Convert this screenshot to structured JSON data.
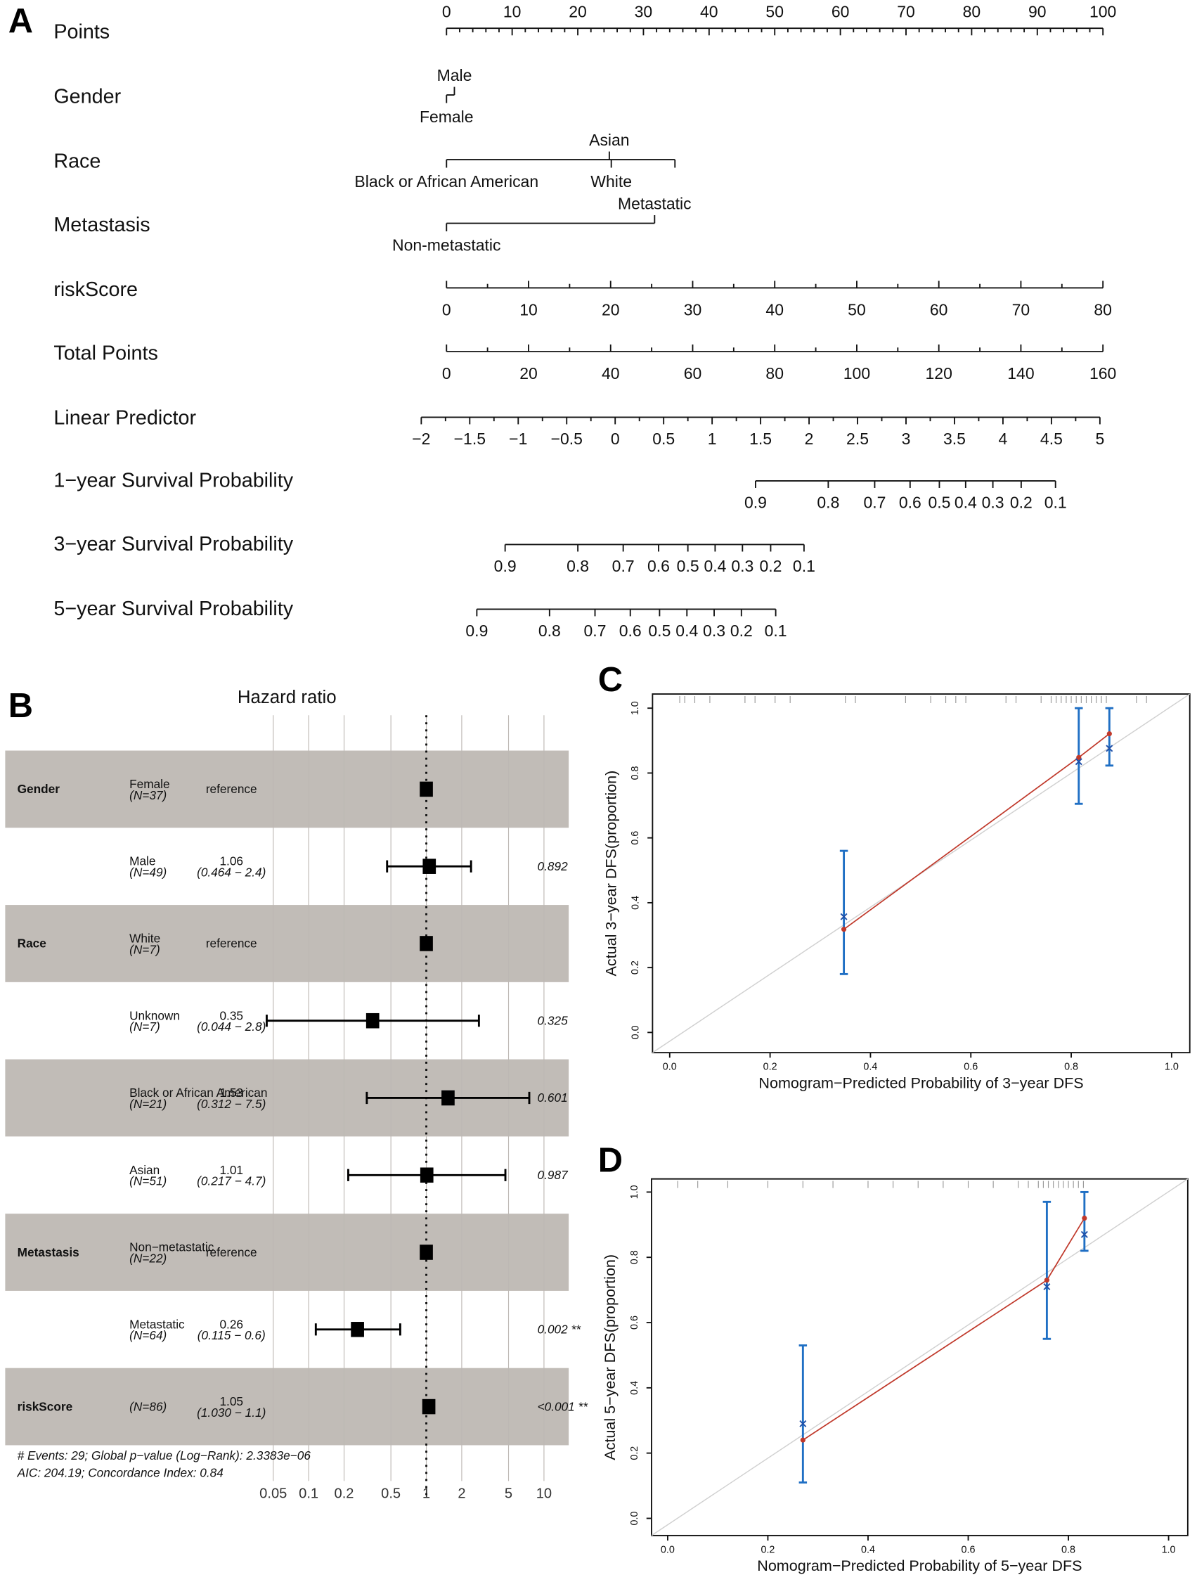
{
  "panels": {
    "a": "A",
    "b": "B",
    "c": "C",
    "d": "D"
  },
  "chart_data": [
    {
      "type": "nomogram",
      "rows": [
        {
          "label": "Points",
          "kind": "scale",
          "min": 0,
          "max": 100,
          "major": 10,
          "minor": 2,
          "labels_above": true
        },
        {
          "label": "Gender",
          "kind": "factor",
          "levels": [
            {
              "name": "Female",
              "points": 0,
              "pos": "below"
            },
            {
              "name": "Male",
              "points": 1.2,
              "pos": "above"
            }
          ]
        },
        {
          "label": "Race",
          "kind": "factor",
          "levels": [
            {
              "name": "Black or African American",
              "points": 0,
              "pos": "below"
            },
            {
              "name": "Asian",
              "points": 24.8,
              "pos": "above"
            },
            {
              "name": "White",
              "points": 25.1,
              "pos": "below"
            },
            {
              "name": "",
              "points": 34.8,
              "pos": "none"
            }
          ]
        },
        {
          "label": "Metastasis",
          "kind": "factor",
          "levels": [
            {
              "name": "Non-metastatic",
              "points": 0,
              "pos": "below"
            },
            {
              "name": "Metastatic",
              "points": 31.7,
              "pos": "above"
            }
          ]
        },
        {
          "label": "riskScore",
          "kind": "scale",
          "min": 0,
          "max": 80,
          "major": 10,
          "minor": 5,
          "points_max": 100
        },
        {
          "label": "Total Points",
          "kind": "scale",
          "min": 0,
          "max": 160,
          "major": 20,
          "minor": 10,
          "total": true
        },
        {
          "label": "Linear Predictor",
          "kind": "lp",
          "min": -2,
          "max": 5,
          "major": 0.5,
          "tick_labels": [
            "−2",
            "−1.5",
            "−1",
            "−0.5",
            "0",
            "0.5",
            "1",
            "1.5",
            "2",
            "2.5",
            "3",
            "3.5",
            "4",
            "4.5",
            "5"
          ]
        },
        {
          "label": "1−year Survival Probability",
          "kind": "surv",
          "ticks": [
            {
              "p": "0.9",
              "lp": 1.448
            },
            {
              "p": "0.8",
              "lp": 2.198
            },
            {
              "p": "0.7",
              "lp": 2.677
            },
            {
              "p": "0.6",
              "lp": 3.042
            },
            {
              "p": "0.5",
              "lp": 3.344
            },
            {
              "p": "0.4",
              "lp": 3.615
            },
            {
              "p": "0.3",
              "lp": 3.896
            },
            {
              "p": "0.2",
              "lp": 4.188
            },
            {
              "p": "0.1",
              "lp": 4.542
            }
          ]
        },
        {
          "label": "3−year Survival Probability",
          "kind": "surv",
          "ticks": [
            {
              "p": "0.9",
              "lp": -1.135
            },
            {
              "p": "0.8",
              "lp": -0.385
            },
            {
              "p": "0.7",
              "lp": 0.083
            },
            {
              "p": "0.6",
              "lp": 0.448
            },
            {
              "p": "0.5",
              "lp": 0.75
            },
            {
              "p": "0.4",
              "lp": 1.031
            },
            {
              "p": "0.3",
              "lp": 1.313
            },
            {
              "p": "0.2",
              "lp": 1.604
            },
            {
              "p": "0.1",
              "lp": 1.948
            }
          ]
        },
        {
          "label": "5−year Survival Probability",
          "kind": "surv",
          "ticks": [
            {
              "p": "0.9",
              "lp": -1.427
            },
            {
              "p": "0.8",
              "lp": -0.677
            },
            {
              "p": "0.7",
              "lp": -0.208
            },
            {
              "p": "0.6",
              "lp": 0.156
            },
            {
              "p": "0.5",
              "lp": 0.458
            },
            {
              "p": "0.4",
              "lp": 0.74
            },
            {
              "p": "0.3",
              "lp": 1.021
            },
            {
              "p": "0.2",
              "lp": 1.302
            },
            {
              "p": "0.1",
              "lp": 1.656
            }
          ]
        }
      ]
    },
    {
      "type": "forest",
      "title": "Hazard ratio",
      "x_scale": "log",
      "x_ticks": [
        "0.05",
        "0.1",
        "0.2",
        "0.5",
        "1",
        "2",
        "5",
        "10"
      ],
      "shade_color": "#c1bcb7",
      "rows": [
        {
          "variable": "Gender",
          "level": "Female",
          "n": "(N=37)",
          "hr_text": "reference",
          "ci_text": "",
          "hr": 1,
          "lo": null,
          "hi": null,
          "p": "",
          "shaded": true
        },
        {
          "variable": "",
          "level": "Male",
          "n": "(N=49)",
          "hr_text": "1.06",
          "ci_text": "(0.464 − 2.4)",
          "hr": 1.06,
          "lo": 0.464,
          "hi": 2.4,
          "p": "0.892",
          "shaded": false
        },
        {
          "variable": "Race",
          "level": "White",
          "n": "(N=7)",
          "hr_text": "reference",
          "ci_text": "",
          "hr": 1,
          "lo": null,
          "hi": null,
          "p": "",
          "shaded": true
        },
        {
          "variable": "",
          "level": "Unknown",
          "n": "(N=7)",
          "hr_text": "0.35",
          "ci_text": "(0.044 − 2.8)",
          "hr": 0.35,
          "lo": 0.044,
          "hi": 2.8,
          "p": "0.325",
          "shaded": false
        },
        {
          "variable": "",
          "level": "Black or African American",
          "n": "(N=21)",
          "hr_text": "1.53",
          "ci_text": "(0.312 − 7.5)",
          "hr": 1.53,
          "lo": 0.312,
          "hi": 7.5,
          "p": "0.601",
          "shaded": true
        },
        {
          "variable": "",
          "level": "Asian",
          "n": "(N=51)",
          "hr_text": "1.01",
          "ci_text": "(0.217 − 4.7)",
          "hr": 1.01,
          "lo": 0.217,
          "hi": 4.7,
          "p": "0.987",
          "shaded": false
        },
        {
          "variable": "Metastasis",
          "level": "Non−metastatic",
          "n": "(N=22)",
          "hr_text": "reference",
          "ci_text": "",
          "hr": 1,
          "lo": null,
          "hi": null,
          "p": "",
          "shaded": true
        },
        {
          "variable": "",
          "level": "Metastatic",
          "n": "(N=64)",
          "hr_text": "0.26",
          "ci_text": "(0.115 − 0.6)",
          "hr": 0.26,
          "lo": 0.115,
          "hi": 0.6,
          "p": "0.002 **",
          "shaded": false
        },
        {
          "variable": "riskScore",
          "level": "",
          "n": "(N=86)",
          "hr_text": "1.05",
          "ci_text": "(1.030 − 1.1)",
          "hr": 1.05,
          "lo": 1.03,
          "hi": 1.1,
          "p": "<0.001 **",
          "shaded": true
        }
      ],
      "footer": [
        "# Events: 29; Global p−value (Log−Rank): 2.3383e−06",
        "AIC: 204.19; Concordance Index: 0.84"
      ]
    },
    {
      "type": "calibration",
      "xlabel": "Nomogram−Predicted Probability of 3−year DFS",
      "ylabel": "Actual 3−year DFS(proportion)",
      "xlim": [
        0,
        1
      ],
      "ylim": [
        0,
        1
      ],
      "ticks": [
        "0.0",
        "0.2",
        "0.4",
        "0.6",
        "0.8",
        "1.0"
      ],
      "colors": {
        "observed": "#c0392b",
        "corrected": "#1f4fa8",
        "ci": "#1f6fc4",
        "ideal": "#d0d0d0"
      },
      "points": [
        {
          "predicted": 0.347,
          "observed": 0.318,
          "corrected": 0.357,
          "ci": [
            0.18,
            0.56
          ]
        },
        {
          "predicted": 0.815,
          "observed": 0.848,
          "corrected": 0.835,
          "ci": [
            0.705,
            1.0
          ]
        },
        {
          "predicted": 0.876,
          "observed": 0.921,
          "corrected": 0.876,
          "ci": [
            0.823,
            1.0
          ]
        }
      ],
      "rug": [
        0.02,
        0.03,
        0.05,
        0.08,
        0.15,
        0.17,
        0.21,
        0.24,
        0.35,
        0.37,
        0.47,
        0.52,
        0.55,
        0.57,
        0.59,
        0.67,
        0.69,
        0.74,
        0.76,
        0.77,
        0.78,
        0.79,
        0.8,
        0.81,
        0.82,
        0.83,
        0.84,
        0.85,
        0.86,
        0.86,
        0.87,
        0.93,
        0.95
      ]
    },
    {
      "type": "calibration",
      "xlabel": "Nomogram−Predicted Probability of 5−year DFS",
      "ylabel": "Actual 5−year DFS(proportion)",
      "xlim": [
        0,
        1
      ],
      "ylim": [
        0,
        1
      ],
      "ticks": [
        "0.0",
        "0.2",
        "0.4",
        "0.6",
        "0.8",
        "1.0"
      ],
      "colors": {
        "observed": "#c0392b",
        "corrected": "#1f4fa8",
        "ci": "#1f6fc4",
        "ideal": "#d0d0d0"
      },
      "points": [
        {
          "predicted": 0.27,
          "observed": 0.24,
          "corrected": 0.29,
          "ci": [
            0.11,
            0.53
          ]
        },
        {
          "predicted": 0.757,
          "observed": 0.73,
          "corrected": 0.71,
          "ci": [
            0.55,
            0.97
          ]
        },
        {
          "predicted": 0.832,
          "observed": 0.92,
          "corrected": 0.87,
          "ci": [
            0.82,
            1.0
          ]
        }
      ],
      "rug": [
        0.02,
        0.06,
        0.12,
        0.2,
        0.27,
        0.33,
        0.4,
        0.45,
        0.5,
        0.55,
        0.6,
        0.65,
        0.7,
        0.72,
        0.74,
        0.75,
        0.76,
        0.77,
        0.78,
        0.79,
        0.8,
        0.81,
        0.82,
        0.83
      ]
    }
  ]
}
